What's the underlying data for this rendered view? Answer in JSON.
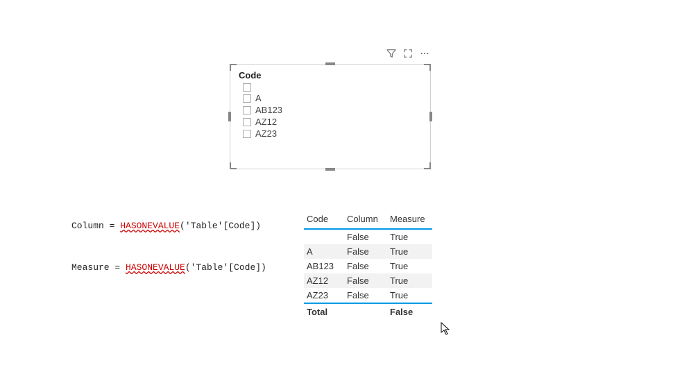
{
  "slicer": {
    "title": "Code",
    "items": [
      "",
      "A",
      "AB123",
      "AZ12",
      "AZ23"
    ]
  },
  "formulas": {
    "column": {
      "lhs": "Column = ",
      "fn": "HASONEVALUE",
      "arg": "('Table'[Code])"
    },
    "measure": {
      "lhs": "Measure = ",
      "fn": "HASONEVALUE",
      "arg": "('Table'[Code])"
    }
  },
  "table": {
    "headers": {
      "code": "Code",
      "column": "Column",
      "measure": "Measure"
    },
    "rows": [
      {
        "code": "",
        "column": "False",
        "measure": "True"
      },
      {
        "code": "A",
        "column": "False",
        "measure": "True"
      },
      {
        "code": "AB123",
        "column": "False",
        "measure": "True"
      },
      {
        "code": "AZ12",
        "column": "False",
        "measure": "True"
      },
      {
        "code": "AZ23",
        "column": "False",
        "measure": "True"
      }
    ],
    "total": {
      "label": "Total",
      "column": "",
      "measure": "False"
    }
  }
}
